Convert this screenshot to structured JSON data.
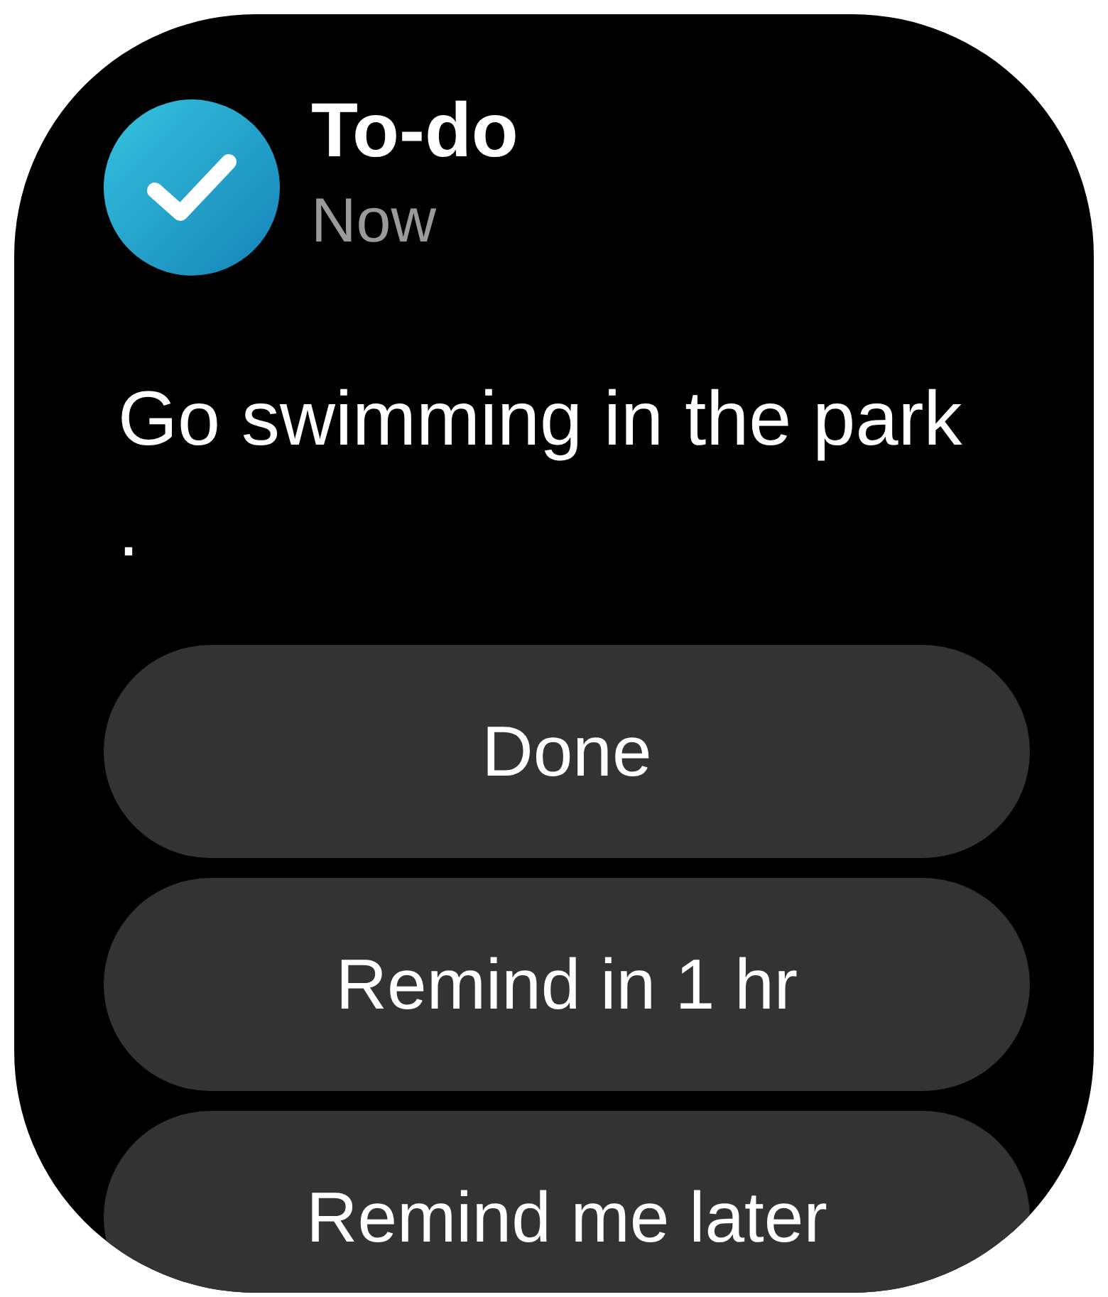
{
  "notification": {
    "app": "To-do",
    "time": "Now",
    "message": "Go swimming in the park ."
  },
  "actions": [
    {
      "label": "Done"
    },
    {
      "label": "Remind in 1 hr"
    },
    {
      "label": "Remind me later"
    }
  ]
}
